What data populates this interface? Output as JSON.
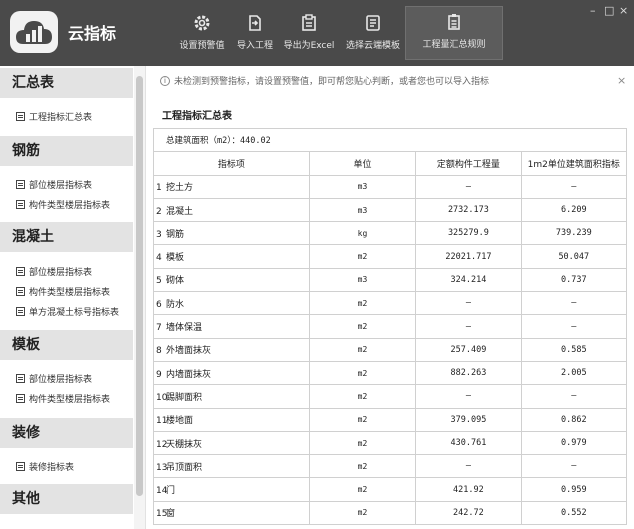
{
  "app": {
    "name": "云指标"
  },
  "toolbar": {
    "items": [
      {
        "label": "设置预警值",
        "icon": "gear-icon"
      },
      {
        "label": "导入工程",
        "icon": "import-icon"
      },
      {
        "label": "导出为Excel",
        "icon": "excel-export-icon"
      },
      {
        "label": "选择云端模板",
        "icon": "template-icon"
      },
      {
        "label": "工程量汇总规则",
        "icon": "rules-document-icon"
      }
    ],
    "window_controls": {
      "minimize": "–",
      "maximize": "□",
      "close": "×"
    }
  },
  "sidebar": {
    "sections": [
      {
        "title": "汇总表",
        "items": [
          "工程指标汇总表"
        ]
      },
      {
        "title": "钢筋",
        "items": [
          "部位楼层指标表",
          "构件类型楼层指标表"
        ]
      },
      {
        "title": "混凝土",
        "items": [
          "部位楼层指标表",
          "构件类型楼层指标表",
          "单方混凝土标号指标表"
        ]
      },
      {
        "title": "模板",
        "items": [
          "部位楼层指标表",
          "构件类型楼层指标表"
        ]
      },
      {
        "title": "装修",
        "items": [
          "装修指标表"
        ]
      },
      {
        "title": "其他",
        "items": []
      }
    ]
  },
  "main": {
    "notice": "未检测到预警指标，请设置预警值，即可帮您贴心判断，或者您也可以导入指标",
    "close_symbol": "×",
    "section_title": "工程指标汇总表",
    "table": {
      "area_label": "总建筑面积（m2）：440.02",
      "headers": [
        "指标项",
        "单位",
        "定额构件工程量",
        "1m2单位建筑面积指标"
      ],
      "rows": [
        {
          "no": "1",
          "name": "挖土方",
          "unit": "m3",
          "qty": "—",
          "index": "—"
        },
        {
          "no": "2",
          "name": "混凝土",
          "unit": "m3",
          "qty": "2732.173",
          "index": "6.209"
        },
        {
          "no": "3",
          "name": "钢筋",
          "unit": "kg",
          "qty": "325279.9",
          "index": "739.239"
        },
        {
          "no": "4",
          "name": "模板",
          "unit": "m2",
          "qty": "22021.717",
          "index": "50.047"
        },
        {
          "no": "5",
          "name": "砌体",
          "unit": "m3",
          "qty": "324.214",
          "index": "0.737"
        },
        {
          "no": "6",
          "name": "防水",
          "unit": "m2",
          "qty": "—",
          "index": "—"
        },
        {
          "no": "7",
          "name": "墙体保温",
          "unit": "m2",
          "qty": "—",
          "index": "—"
        },
        {
          "no": "8",
          "name": "外墙面抹灰",
          "unit": "m2",
          "qty": "257.409",
          "index": "0.585"
        },
        {
          "no": "9",
          "name": "内墙面抹灰",
          "unit": "m2",
          "qty": "882.263",
          "index": "2.005"
        },
        {
          "no": "10",
          "name": "踢脚面积",
          "unit": "m2",
          "qty": "—",
          "index": "—"
        },
        {
          "no": "11",
          "name": "楼地面",
          "unit": "m2",
          "qty": "379.095",
          "index": "0.862"
        },
        {
          "no": "12",
          "name": "天棚抹灰",
          "unit": "m2",
          "qty": "430.761",
          "index": "0.979"
        },
        {
          "no": "13",
          "name": "吊顶面积",
          "unit": "m2",
          "qty": "—",
          "index": "—"
        },
        {
          "no": "14",
          "name": "门",
          "unit": "m2",
          "qty": "421.92",
          "index": "0.959"
        },
        {
          "no": "15",
          "name": "窗",
          "unit": "m2",
          "qty": "242.72",
          "index": "0.552"
        }
      ]
    }
  }
}
